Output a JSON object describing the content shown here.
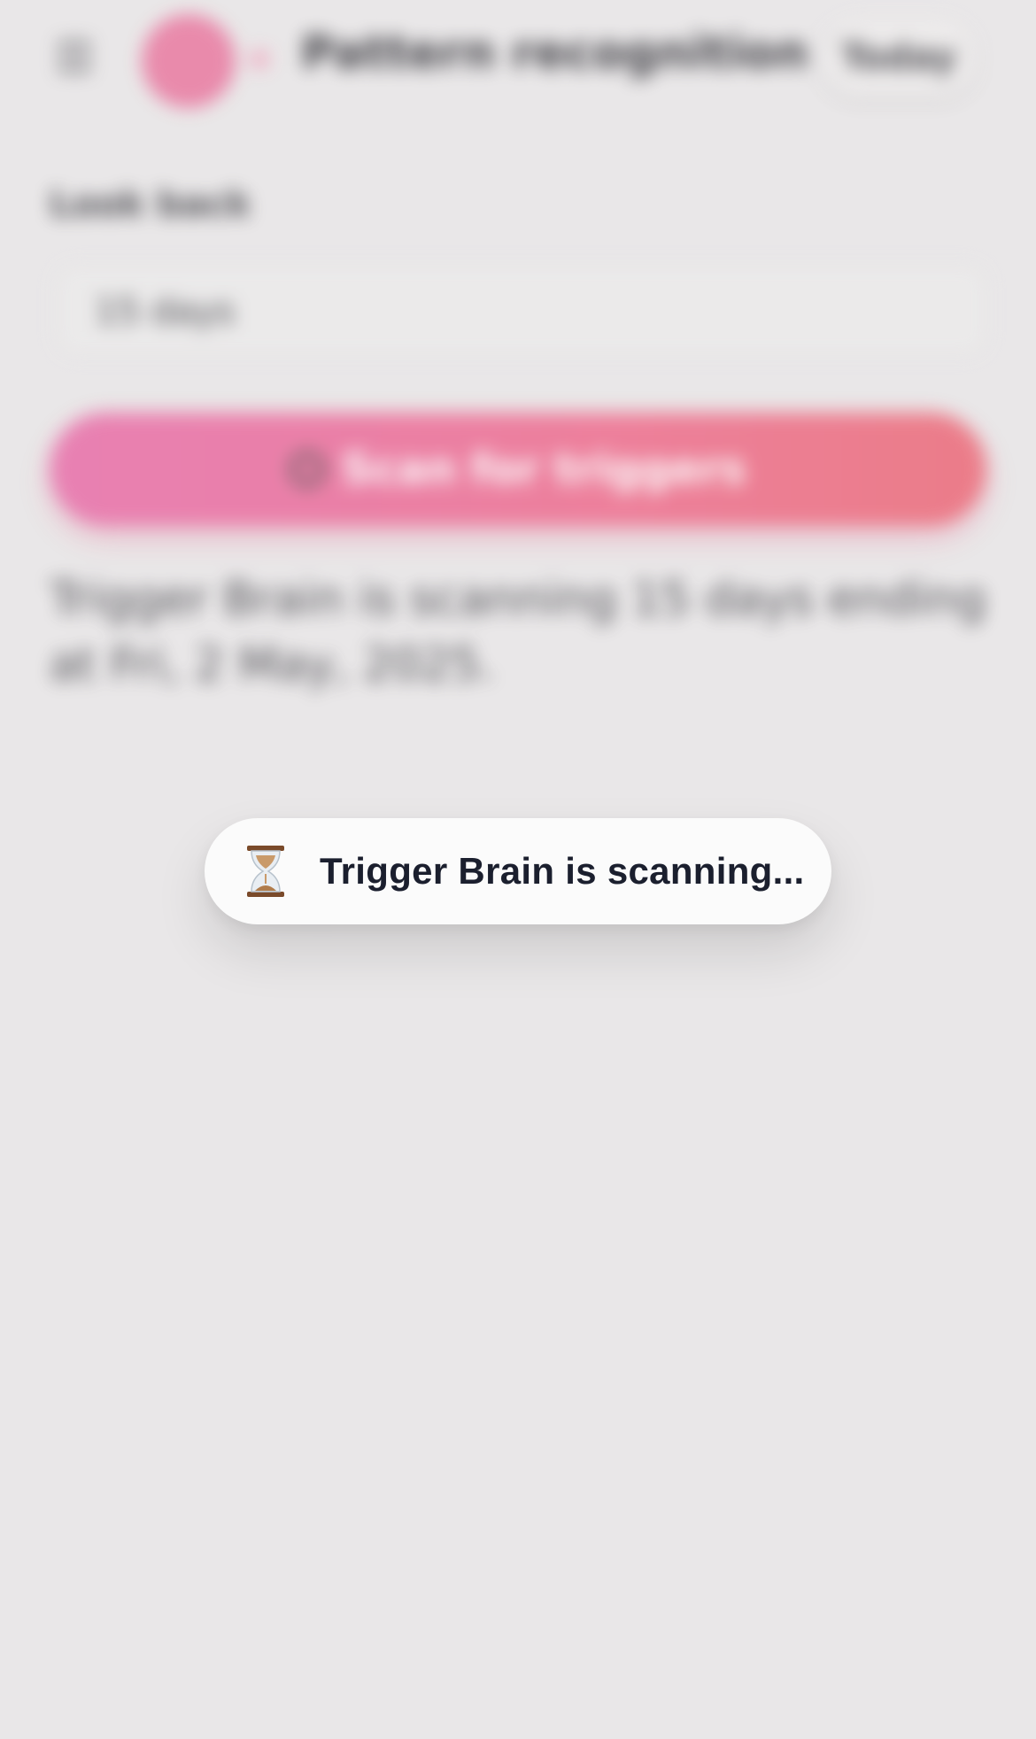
{
  "header": {
    "title": "Pattern recognition",
    "today_label": "Today"
  },
  "lookback": {
    "label": "Look back",
    "value": "15 days"
  },
  "scan_button": {
    "label": "Scan for triggers"
  },
  "status": {
    "text": "Trigger Brain is scanning 15 days ending at Fri, 2 May, 2025."
  },
  "toast": {
    "text": "Trigger Brain is scanning..."
  },
  "colors": {
    "background": "#e9e7e8",
    "accent_gradient_start": "#e86faa",
    "accent_gradient_end": "#ec6a78",
    "toast_background": "#fbfbfb",
    "toast_text": "#1b1f2e"
  },
  "icons": {
    "menu": "hamburger-menu-icon",
    "logo": "logo-circle",
    "scan": "magnifier-icon",
    "toast": "hourglass-icon"
  }
}
